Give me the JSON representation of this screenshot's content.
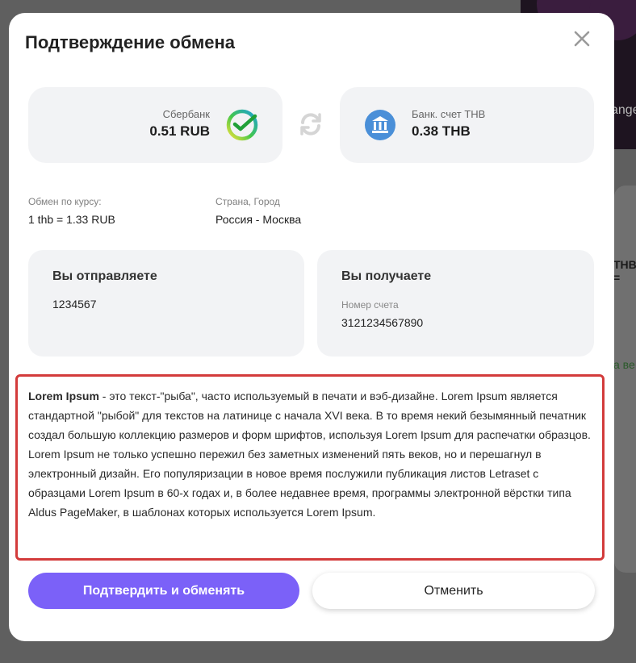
{
  "modal": {
    "title": "Подтверждение обмена"
  },
  "from_account": {
    "name": "Сбербанк",
    "amount": "0.51 RUB",
    "icon": "sberbank-logo"
  },
  "to_account": {
    "name": "Банк. счет THB",
    "amount": "0.38 THB",
    "icon": "bank-building-icon"
  },
  "rate": {
    "label": "Обмен по курсу:",
    "value": "1 thb = 1.33 RUB"
  },
  "location": {
    "label": "Страна, Город",
    "value": "Россия - Москва"
  },
  "send_panel": {
    "title": "Вы отправляете",
    "value": "1234567"
  },
  "receive_panel": {
    "title": "Вы получаете",
    "account_label": "Номер счета",
    "account_value": "3121234567890"
  },
  "notice": {
    "bold_lead": "Lorem Ipsum",
    "text": " - это текст-\"рыба\", часто используемый в печати и вэб-дизайне. Lorem Ipsum является стандартной \"рыбой\" для текстов на латинице с начала XVI века. В то время некий безымянный печатник создал большую коллекцию размеров и форм шрифтов, используя Lorem Ipsum для распечатки образцов. Lorem Ipsum не только успешно пережил без заметных изменений пять веков, но и перешагнул в электронный дизайн. Его популяризации в новое время послужили публикация листов Letraset с образцами Lorem Ipsum в 60-х годах и, в более недавнее время, программы электронной вёрстки типа Aldus PageMaker, в шаблонах которых используется Lorem Ipsum."
  },
  "actions": {
    "confirm": "Подтвердить и обменять",
    "cancel": "Отменить"
  },
  "background": {
    "banner_text": "ange",
    "side_text": "THB =",
    "green_text": "а ве"
  },
  "colors": {
    "accent": "#7b61f8",
    "highlight_border": "#d33b3b",
    "card_bg": "#f2f3f5"
  }
}
